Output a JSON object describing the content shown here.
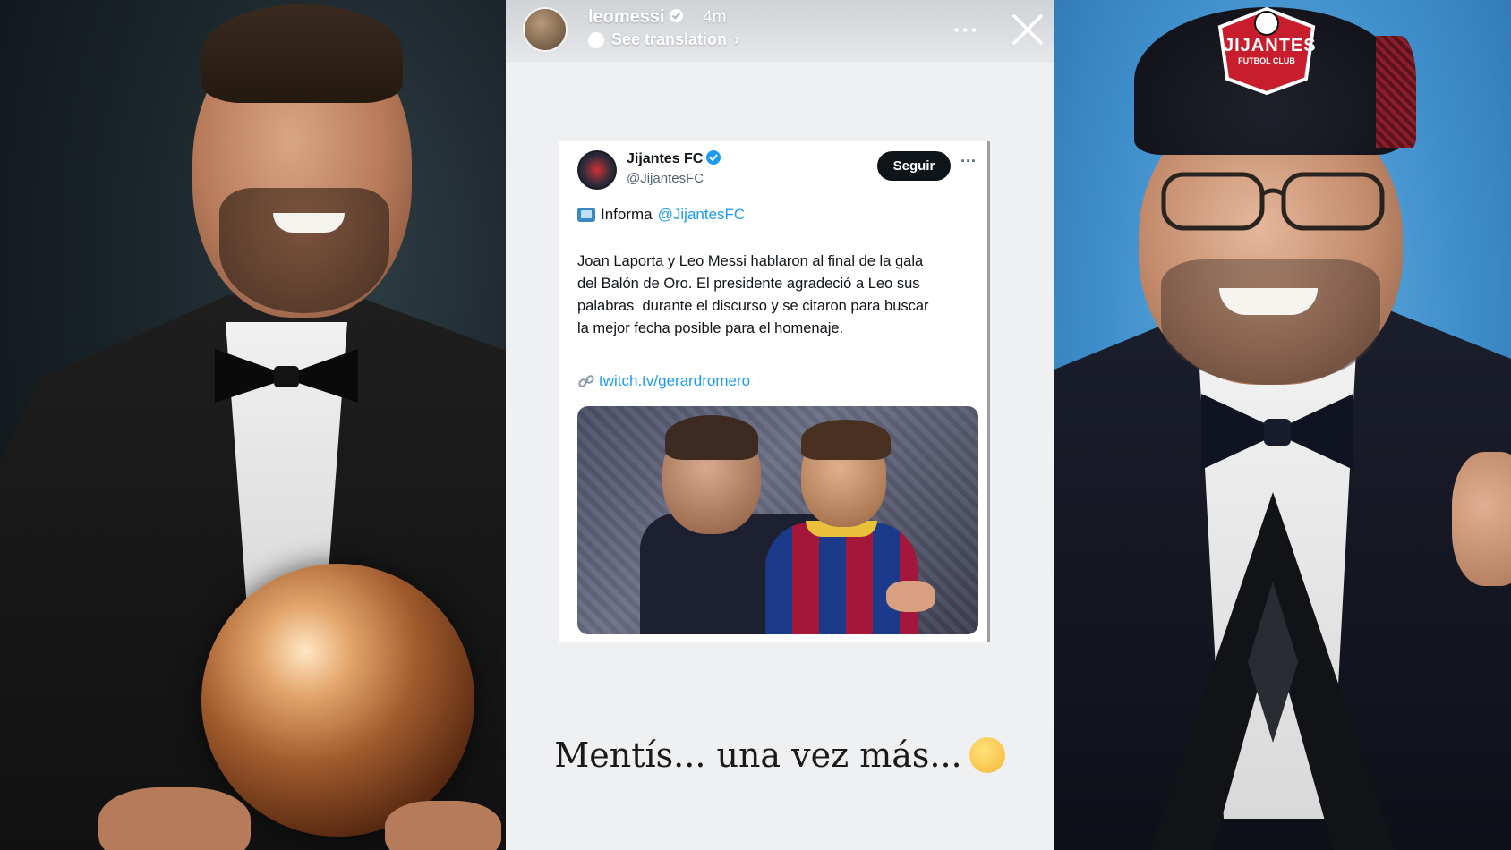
{
  "story": {
    "username": "leomessi",
    "time": "4m",
    "translate_label": "See translation",
    "translate_chevron": "›",
    "more_label": "···",
    "caption": "Mentís... una vez más..."
  },
  "tweet": {
    "author_name": "Jijantes FC",
    "handle": "@JijantesFC",
    "follow_label": "Seguir",
    "more_label": "···",
    "informa_prefix": "Informa",
    "informa_mention": "@JijantesFC",
    "body_lines": [
      "Joan Laporta y Leo Messi hablaron al final de la gala",
      "del Balón de Oro. El presidente agradeció a Leo sus",
      "palabras  durante el discurso y se citaron para buscar",
      "la mejor fecha posible para el homenaje."
    ],
    "link": "twitch.tv/gerardromero"
  },
  "right_photo": {
    "cap_badge_text": "JIJANTES",
    "cap_badge_sub": "FUTBOL CLUB"
  },
  "colors": {
    "story_bg": "#eef0f2",
    "twitter_blue": "#1d9bf0",
    "follow_button": "#0f1419",
    "right_bg": "#3f8fcc"
  },
  "icons": {
    "close": "close-icon",
    "verified": "verified-badge-icon",
    "link": "link-icon",
    "tv": "tv-icon",
    "thinking_emoji": "thinking-face-icon"
  }
}
